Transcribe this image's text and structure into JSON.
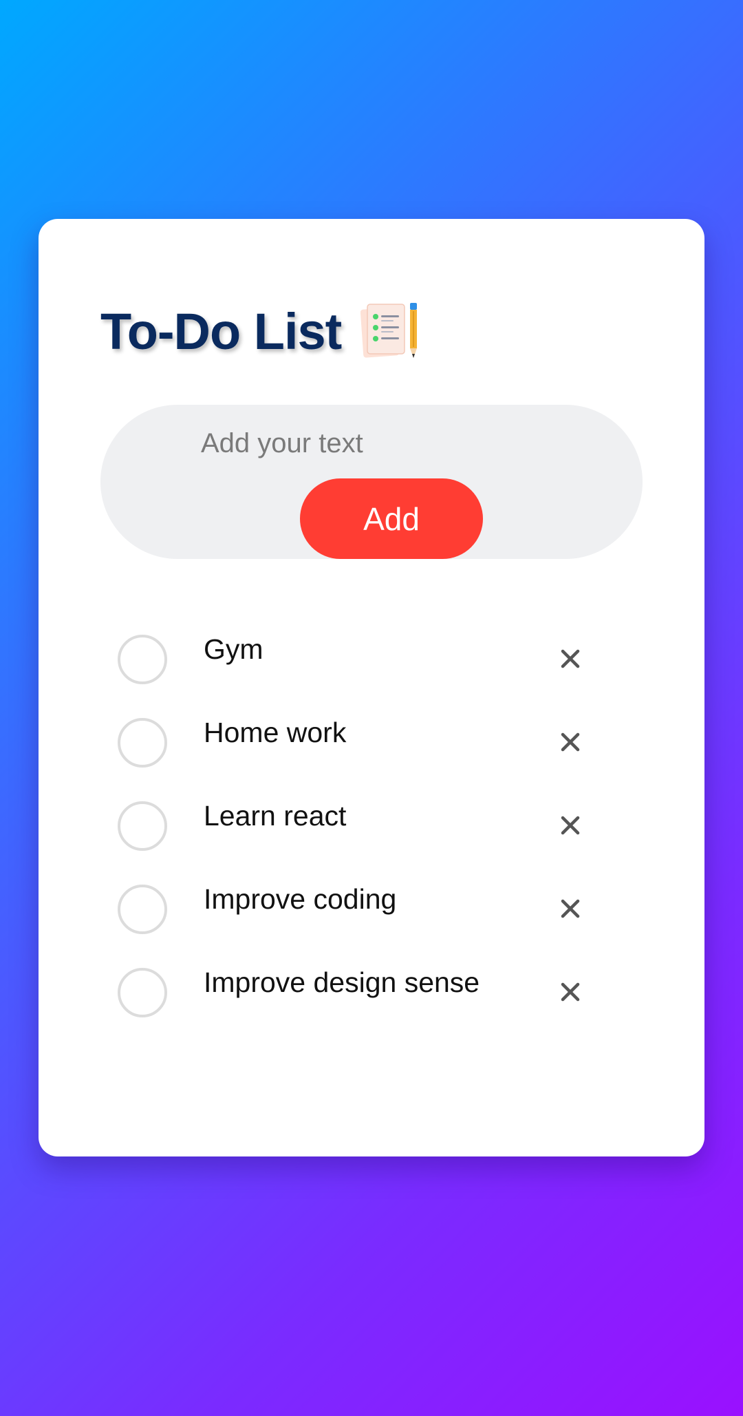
{
  "header": {
    "title": "To-Do List",
    "title_icon": "notepad-pencil-icon"
  },
  "input": {
    "placeholder": "Add your text",
    "value": "",
    "add_label": "Add"
  },
  "todos": [
    {
      "text": "Gym",
      "checked": false,
      "delete_icon": "close-icon"
    },
    {
      "text": "Home work",
      "checked": false,
      "delete_icon": "close-icon"
    },
    {
      "text": "Learn react",
      "checked": false,
      "delete_icon": "close-icon"
    },
    {
      "text": "Improve coding",
      "checked": false,
      "delete_icon": "close-icon"
    },
    {
      "text": "Improve design sense",
      "checked": false,
      "delete_icon": "close-icon"
    }
  ],
  "colors": {
    "background_start": "#00a8ff",
    "background_end": "#9a10ff",
    "card": "#ffffff",
    "title": "#0a2a5e",
    "input_bg": "#eff0f2",
    "add_button": "#ff3d33",
    "checkbox_border": "#dcdcdc",
    "delete_icon": "#555555"
  }
}
